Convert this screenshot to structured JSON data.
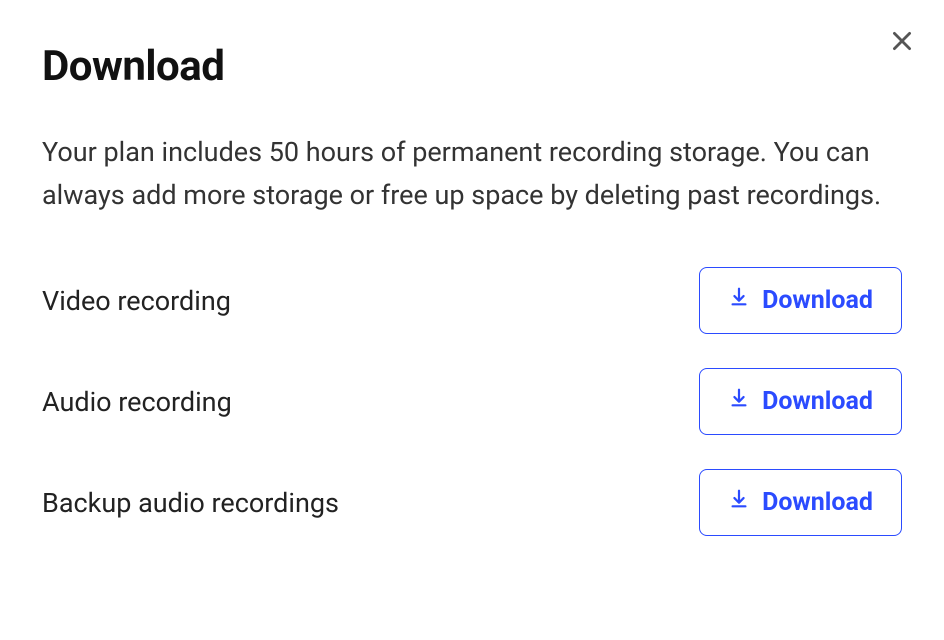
{
  "modal": {
    "title": "Download",
    "description": "Your plan includes 50 hours of permanent recording storage. You can always add more storage or free up space by deleting past recordings.",
    "items": [
      {
        "label": "Video recording",
        "button_label": "Download"
      },
      {
        "label": "Audio recording",
        "button_label": "Download"
      },
      {
        "label": "Backup audio recordings",
        "button_label": "Download"
      }
    ],
    "accent_color": "#2B4BFF"
  }
}
